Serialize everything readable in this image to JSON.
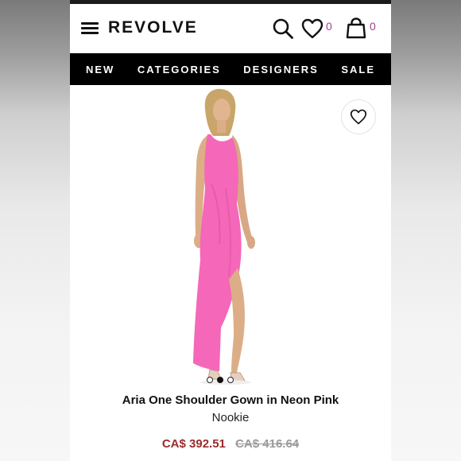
{
  "header": {
    "brand": "REVOLVE",
    "wishlist_count": "0",
    "bag_count": "0"
  },
  "nav": {
    "items": [
      "NEW",
      "CATEGORIES",
      "DESIGNERS",
      "SALE"
    ]
  },
  "product": {
    "title": "Aria One Shoulder Gown in Neon Pink",
    "designer": "Nookie",
    "sale_price": "CA$ 392.51",
    "original_price": "CA$ 416.64",
    "dress_color": "#f567b8",
    "image_count": 3,
    "active_image_index": 2
  },
  "colors": {
    "accent": "#a2418f",
    "sale": "#9b2b2b",
    "nav_bg": "#000000"
  },
  "icons": [
    "menu-icon",
    "search-icon",
    "heart-icon",
    "bag-icon",
    "heart-outline-icon"
  ]
}
